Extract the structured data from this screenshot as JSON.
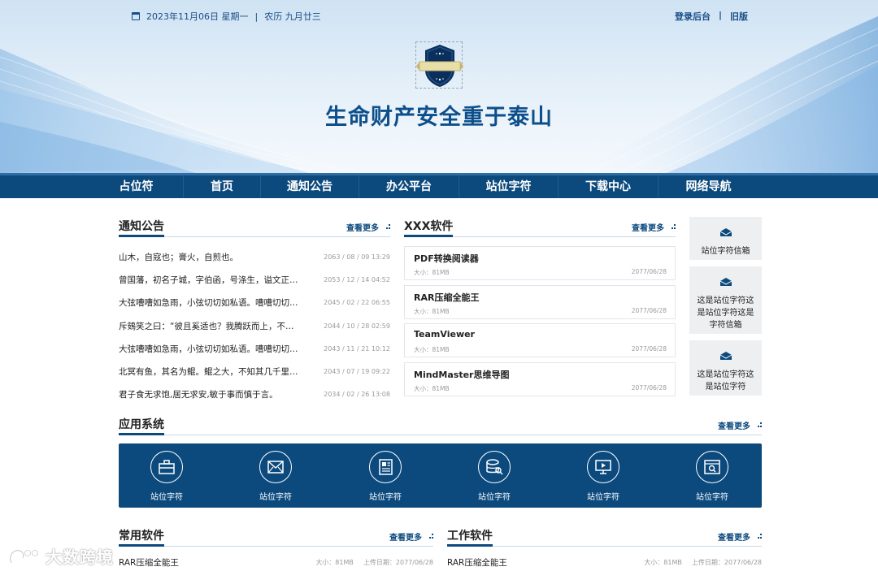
{
  "header": {
    "date": "2023年11月06日 星期一",
    "lunar": "农历 九月廿三",
    "separator": "|",
    "links": [
      "登录后台",
      "旧版"
    ],
    "title": "生命财产安全重于泰山"
  },
  "nav": {
    "items": [
      "占位符",
      "首页",
      "通知公告",
      "办公平台",
      "站位字符",
      "下载中心",
      "网络导航"
    ]
  },
  "notices": {
    "title": "通知公告",
    "more": "查看更多",
    "items": [
      {
        "text": "山木，自寇也；膏火，自煎也。",
        "date": "2063 / 08 / 09 13:29"
      },
      {
        "text": "曾国藩，初名子城，字伯函，号涤生，谥文正…",
        "date": "2053 / 12 / 14 04:52"
      },
      {
        "text": "大弦嘈嘈如急雨，小弦切切如私语。嘈嘈切切…",
        "date": "2045 / 02 / 22 06:55"
      },
      {
        "text": "斥鴳笑之曰：“彼且奚适也？我腾跃而上，不…",
        "date": "2044 / 10 / 28 02:59"
      },
      {
        "text": "大弦嘈嘈如急雨，小弦切切如私语。嘈嘈切切…",
        "date": "2043 / 11 / 21 10:12"
      },
      {
        "text": "北冥有鱼，其名为鲲。鲲之大，不知其几千里…",
        "date": "2043 / 07 / 19 09:22"
      },
      {
        "text": "君子食无求饱,居无求安,敏于事而慎于言。",
        "date": "2034 / 02 / 26 13:08"
      }
    ]
  },
  "software": {
    "title": "XXX软件",
    "more": "查看更多",
    "items": [
      {
        "name": "PDF转换阅读器",
        "size": "大小：81MB",
        "date": "2077/06/28"
      },
      {
        "name": "RAR压缩全能王",
        "size": "大小：81MB",
        "date": "2077/06/28"
      },
      {
        "name": "TeamViewer",
        "size": "大小：81MB",
        "date": "2077/06/28"
      },
      {
        "name": "MindMaster思维导图",
        "size": "大小：81MB",
        "date": "2077/06/28"
      }
    ]
  },
  "side": {
    "boxes": [
      "站位字符信箱",
      "这是站位字符这是站位字符这是字符信箱",
      "这是站位字符这是站位字符"
    ]
  },
  "apps": {
    "title": "应用系统",
    "more": "查看更多",
    "items": [
      {
        "label": "站位字符",
        "icon": "briefcase-icon"
      },
      {
        "label": "站位字符",
        "icon": "mail-icon"
      },
      {
        "label": "站位字符",
        "icon": "newspaper-icon"
      },
      {
        "label": "站位字符",
        "icon": "database-search-icon"
      },
      {
        "label": "站位字符",
        "icon": "monitor-play-icon"
      },
      {
        "label": "站位字符",
        "icon": "browser-search-icon"
      }
    ]
  },
  "common": {
    "title": "常用软件",
    "more": "查看更多",
    "row": {
      "name": "RAR压缩全能王",
      "size": "大小：81MB",
      "upload": "上传日期：2077/06/28"
    }
  },
  "work": {
    "title": "工作软件",
    "more": "查看更多",
    "row": {
      "name": "RAR压缩全能王",
      "size": "大小：81MB",
      "upload": "上传日期：2077/06/28"
    }
  },
  "watermark": {
    "text": "大数跨境"
  },
  "colors": {
    "primary": "#0c4a7e",
    "title": "#0d4f8b",
    "panel": "#eeeff1"
  }
}
